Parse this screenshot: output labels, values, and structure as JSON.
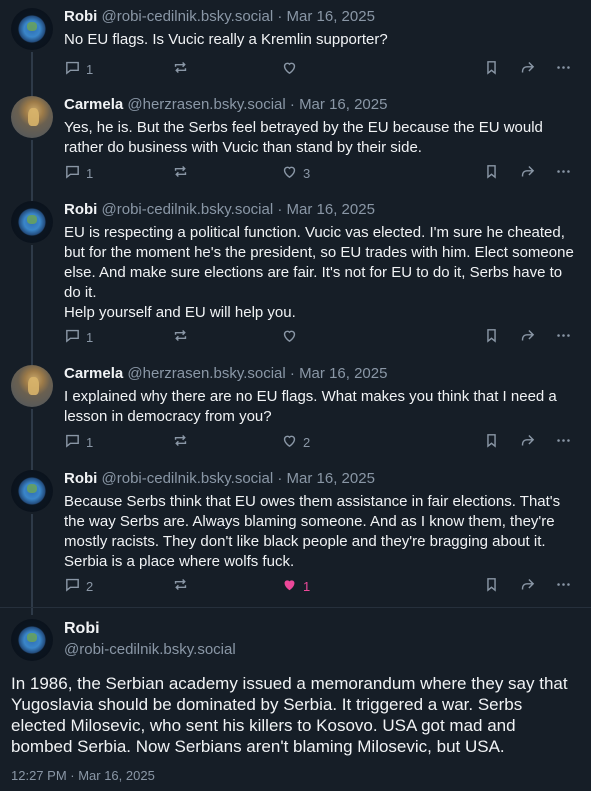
{
  "posts": [
    {
      "name": "Robi",
      "handle": "@robi-cedilnik.bsky.social",
      "date": "Mar 16, 2025",
      "text": "No EU flags. Is Vucic really a Kremlin supporter?",
      "replies": "1",
      "reposts": "",
      "likes": "",
      "liked": false,
      "avatar": "earth"
    },
    {
      "name": "Carmela",
      "handle": "@herzrasen.bsky.social",
      "date": "Mar 16, 2025",
      "text": "Yes, he is. But the Serbs feel betrayed by the EU because the EU would rather do business with Vucic than stand by their side.",
      "replies": "1",
      "reposts": "",
      "likes": "3",
      "liked": false,
      "avatar": "carmela"
    },
    {
      "name": "Robi",
      "handle": "@robi-cedilnik.bsky.social",
      "date": "Mar 16, 2025",
      "text": "EU is respecting a political function. Vucic vas elected. I'm sure he cheated, but for the moment he's the president, so EU trades with him. Elect someone else. And make sure elections are fair. It's not for EU to do it, Serbs have to do it.\nHelp yourself and EU will help you.",
      "replies": "1",
      "reposts": "",
      "likes": "",
      "liked": false,
      "avatar": "earth"
    },
    {
      "name": "Carmela",
      "handle": "@herzrasen.bsky.social",
      "date": "Mar 16, 2025",
      "text": "I explained why there are no EU flags. What makes you think that I need a lesson in democracy from you?",
      "replies": "1",
      "reposts": "",
      "likes": "2",
      "liked": false,
      "avatar": "carmela"
    },
    {
      "name": "Robi",
      "handle": "@robi-cedilnik.bsky.social",
      "date": "Mar 16, 2025",
      "text": "Because Serbs think that EU owes them assistance in fair elections. That's the way Serbs are. Always blaming someone. And as I know them, they're mostly racists. They don't like black people and they're bragging about it. Serbia is a place where wolfs fuck.",
      "replies": "2",
      "reposts": "",
      "likes": "1",
      "liked": true,
      "avatar": "earth"
    }
  ],
  "main": {
    "name": "Robi",
    "handle": "@robi-cedilnik.bsky.social",
    "text": "In 1986, the Serbian academy issued a memorandum where they say that Yugoslavia should be dominated by Serbia. It triggered a war. Serbs elected Milosevic, who sent his killers to Kosovo. USA got mad and bombed Serbia. Now Serbians aren't blaming Milosevic, but USA.",
    "timestamp": "12:27 PM · Mar 16, 2025"
  },
  "colors": {
    "background": "#161e27",
    "muted": "#8a97a6",
    "liked": "#ec4899"
  }
}
